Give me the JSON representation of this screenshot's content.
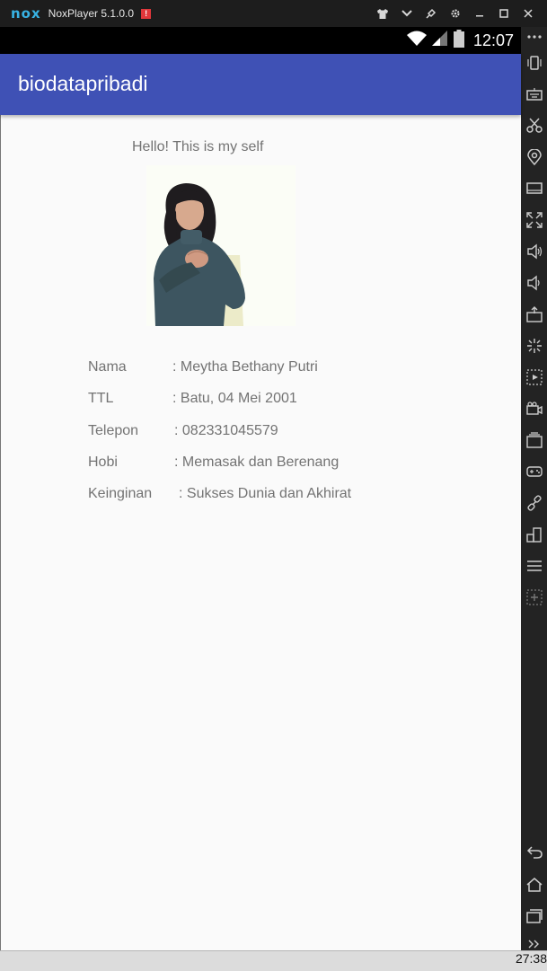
{
  "window": {
    "logo": "nox",
    "title": "NoxPlayer 5.1.0.0",
    "alert_badge": "!",
    "controls": [
      "shirt-icon",
      "chevron-down-icon",
      "pin-icon",
      "gear-icon",
      "minimize-icon",
      "maximize-icon",
      "close-icon"
    ]
  },
  "statusbar": {
    "time": "12:07",
    "icons": [
      "wifi-icon",
      "signal-icon",
      "battery-icon"
    ]
  },
  "appbar": {
    "title": "biodatapribadi"
  },
  "main": {
    "greeting": "Hello! This is my self",
    "photo": "profile-photo",
    "bio": [
      {
        "label": "Nama",
        "value": ": Meytha Bethany Putri"
      },
      {
        "label": "TTL",
        "value": ": Batu, 04 Mei 2001"
      },
      {
        "label": "Telepon",
        "value": ": 082331045579"
      },
      {
        "label": "Hobi",
        "value": ": Memasak dan Berenang"
      },
      {
        "label": "Keinginan",
        "value": ": Sukses Dunia dan Akhirat"
      }
    ]
  },
  "toolbar": {
    "items": [
      "more-icon",
      "phone-rotate-icon",
      "keyboard-icon",
      "scissors-icon",
      "location-icon",
      "screen-icon",
      "fullscreen-icon",
      "volume-up-icon",
      "volume-down-icon",
      "apk-install-icon",
      "shake-icon",
      "macro-icon",
      "video-record-icon",
      "multi-instance-icon",
      "gamepad-icon",
      "link-icon",
      "resize-icon",
      "menu-icon",
      "add-icon"
    ],
    "nav": [
      "back-icon",
      "home-icon",
      "recents-icon",
      "expand-icon"
    ]
  },
  "taskbar": {
    "time": "27:38"
  },
  "colors": {
    "primary": "#3f51b5",
    "text_secondary": "#737373",
    "background": "#fafafa"
  }
}
